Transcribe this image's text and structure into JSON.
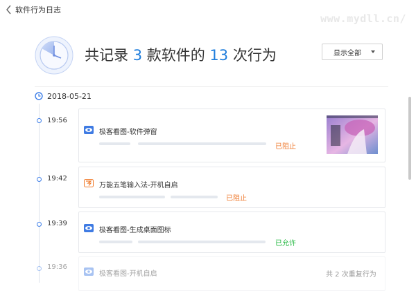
{
  "window": {
    "title": "软件行为日志",
    "watermark": "www.mydll.cn/"
  },
  "summary": {
    "prefix": "共记录 ",
    "app_count": "3",
    "mid": " 款软件的 ",
    "behavior_count": "13",
    "suffix": " 次行为"
  },
  "filter": {
    "label": "显示全部"
  },
  "date": "2018-05-21",
  "events": [
    {
      "time": "19:56",
      "title": "极客看图-软件弹窗",
      "status": "已阻止"
    },
    {
      "time": "19:42",
      "title": "万能五笔输入法-开机自启",
      "status": "已阻止"
    },
    {
      "time": "19:39",
      "title": "极客看图-生成桌面图标",
      "status": "已允许"
    },
    {
      "time": "19:36",
      "title": "极客看图-开机自启",
      "status": ""
    }
  ],
  "footer": {
    "note": "共 2 次重复行为"
  },
  "colors": {
    "accent": "#1e7ddc",
    "blocked": "#ef7c32",
    "allowed": "#1db63b"
  },
  "icons": {
    "eye_app": "eye-icon",
    "ime_app": "wubi-icon"
  }
}
